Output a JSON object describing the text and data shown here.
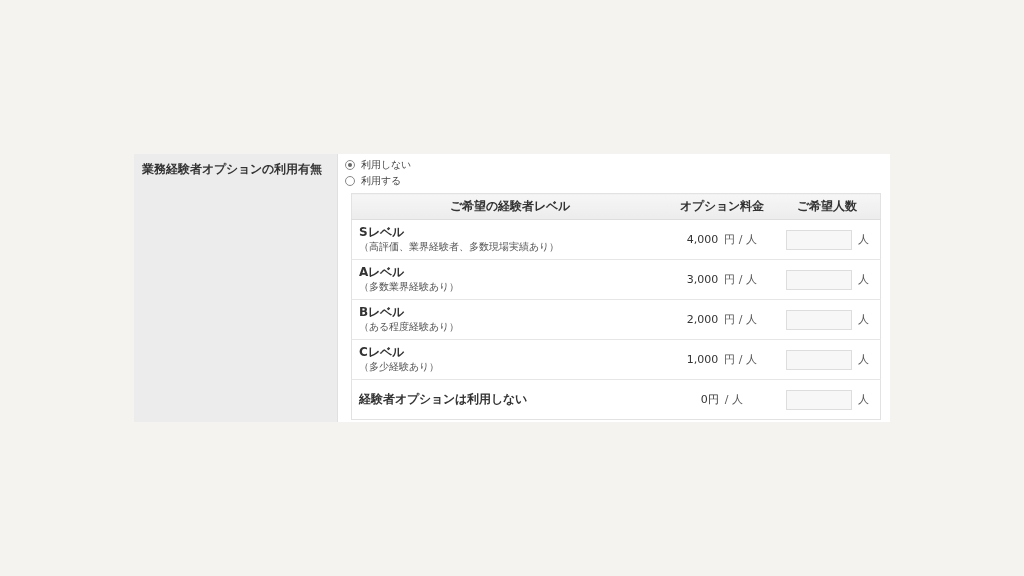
{
  "field_label": "業務経験者オプションの利用有無",
  "radios": [
    {
      "label": "利用しない",
      "selected": true
    },
    {
      "label": "利用する",
      "selected": false
    }
  ],
  "table": {
    "columns": [
      "ご希望の経験者レベル",
      "オプション料金",
      "ご希望人数"
    ],
    "rows": [
      {
        "level": "Sレベル",
        "note": "（高評価、業界経験者、多数現場実績あり）",
        "price": "4,000",
        "price_unit": "円 / 人",
        "count_unit": "人"
      },
      {
        "level": "Aレベル",
        "note": "（多数業界経験あり）",
        "price": "3,000",
        "price_unit": "円 / 人",
        "count_unit": "人"
      },
      {
        "level": "Bレベル",
        "note": "（ある程度経験あり）",
        "price": "2,000",
        "price_unit": "円 / 人",
        "count_unit": "人"
      },
      {
        "level": "Cレベル",
        "note": "（多少経験あり）",
        "price": "1,000",
        "price_unit": "円 / 人",
        "count_unit": "人"
      },
      {
        "level": "経験者オプションは利用しない",
        "price": "0円",
        "price_unit": "/ 人",
        "count_unit": "人"
      }
    ]
  }
}
